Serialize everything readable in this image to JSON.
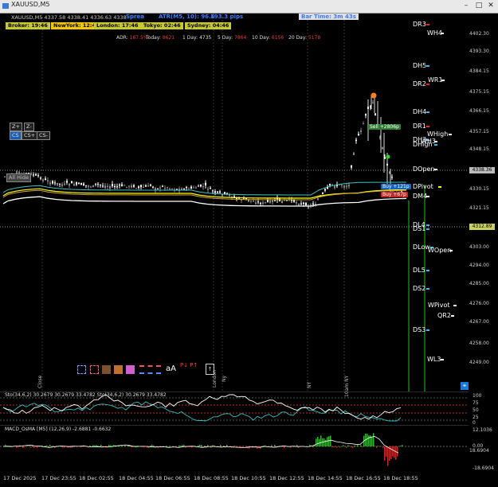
{
  "window": {
    "title": "XAUUSD,M5"
  },
  "header": {
    "ohlc": "XAUUSD,M5  4337.58 4338.41 4336.63 4338.36",
    "spread_label": "Sprea",
    "atr": "ATR(M5, 10): 96.6",
    "pips": "193.3 pips",
    "bar_time": "Bar Time: 3m 43s",
    "clocks": [
      {
        "label": "Broker: 19:46",
        "color": "#c8c832"
      },
      {
        "label": "NewYork: 12:46",
        "color": "#f0c800"
      },
      {
        "label": "London: 17:46",
        "color": "#c8c832"
      },
      {
        "label": "Tokyo: 02:46",
        "color": "#c8c832"
      },
      {
        "label": "Sydney: 04:46",
        "color": "#c8c832"
      }
    ],
    "adr": [
      {
        "label": "ADR:",
        "value": "167.5%"
      },
      {
        "label": "Today:",
        "value": "8621"
      },
      {
        "label": "1 Day:",
        "value": "4735",
        "white": true
      },
      {
        "label": "5 Day:",
        "value": "7864"
      },
      {
        "label": "10 Day:",
        "value": "6156"
      },
      {
        "label": "20 Day:",
        "value": "5178"
      }
    ]
  },
  "buttons": {
    "zoom_in": "Z+",
    "zoom_out": "Z-",
    "cs": "CS",
    "cs_plus": "CS+",
    "cs_minus": "CS-",
    "all_hide": "All Hide"
  },
  "levels": [
    {
      "label": "DR3",
      "color": "#ff2020"
    },
    {
      "label": "WH4",
      "color": "#ffffff"
    },
    {
      "label": "DH5",
      "color": "#30c0ff"
    },
    {
      "label": "DR2",
      "color": "#ff2020"
    },
    {
      "label": "WR1",
      "color": "#ffffff"
    },
    {
      "label": "DH4",
      "color": "#30c0ff"
    },
    {
      "label": "DR1",
      "color": "#ff2020"
    },
    {
      "label": "WHigh",
      "color": "#ffffff"
    },
    {
      "label": "DH3",
      "color": "#30c0ff"
    },
    {
      "label": "WH3",
      "color": "#ffffff"
    },
    {
      "label": "DHigh",
      "color": "#30c0ff"
    },
    {
      "label": "DOpen",
      "color": "#ffffff"
    },
    {
      "label": "DPivot",
      "color": "#ffff00"
    },
    {
      "label": "DM4",
      "color": "#ffffff"
    },
    {
      "label": "DL4",
      "color": "#30c0ff"
    },
    {
      "label": "DS1",
      "color": "#30c0ff"
    },
    {
      "label": "DLow",
      "color": "#30c0ff"
    },
    {
      "label": "WOpen",
      "color": "#ffffff"
    },
    {
      "label": "DL5",
      "color": "#30c0ff"
    },
    {
      "label": "DS2",
      "color": "#30c0ff"
    },
    {
      "label": "WPivot",
      "color": "#ffffff"
    },
    {
      "label": "QR2",
      "color": "#ffffff"
    },
    {
      "label": "DS3",
      "color": "#30c0ff"
    },
    {
      "label": "WL3",
      "color": "#ffffff"
    }
  ],
  "trade_tags": {
    "sell": "Sell +2806p",
    "buy1": "Buy +121p",
    "buy2": "Buy +67p"
  },
  "price_axis": [
    "4402.30",
    "4393.30",
    "4384.15",
    "4375.15",
    "4366.15",
    "4357.15",
    "4348.15",
    "4330.15",
    "4321.15",
    "4303.00",
    "4294.00",
    "4285.00",
    "4276.00",
    "4267.00",
    "4258.00",
    "4249.00"
  ],
  "price_current": "4338.36",
  "price_marker": "4312.89",
  "lower_price": "18.6904",
  "stoch": {
    "label": "Sto(34,6,2) 30.2679 30.2679 33.4782  Sto(34,6,2) 30.2679 33.4782",
    "axis": [
      "100",
      "75",
      "50",
      "25",
      "0"
    ]
  },
  "macd": {
    "label": "MACD_OsMA [M5] (12,26,9) -2.6881 -0.6632",
    "axis": [
      "12.1036",
      "0.00",
      "-18.6904"
    ]
  },
  "time_axis": [
    "17 Dec 2025",
    "17 Dec 23:55",
    "18 Dec 02:55",
    "18 Dec 04:55",
    "18 Dec 06:55",
    "18 Dec 08:55",
    "18 Dec 10:55",
    "18 Dec 12:55",
    "18 Dec 14:55",
    "18 Dec 16:55",
    "18 Dec 18:55"
  ],
  "session_labels": [
    "Close",
    "London",
    "Ny",
    "NY",
    "10am NY"
  ],
  "toolbar_icons": [
    "dashed-box-icon",
    "dashed-red-box-icon",
    "brown-box-icon",
    "orange-box-icon",
    "magenta-box-icon",
    "dash-lines-icon",
    "text-aa-icon",
    "price-labels-icon",
    "chart-toggle-icon"
  ],
  "colors": {
    "bull": "#ffffff",
    "bear": "#9a9a9a",
    "ma_yellow": "#ffff00",
    "ma_white": "#ffffff",
    "ma_cyan": "#40c0c0",
    "osma_up": "#20c020",
    "osma_down": "#e02020"
  }
}
